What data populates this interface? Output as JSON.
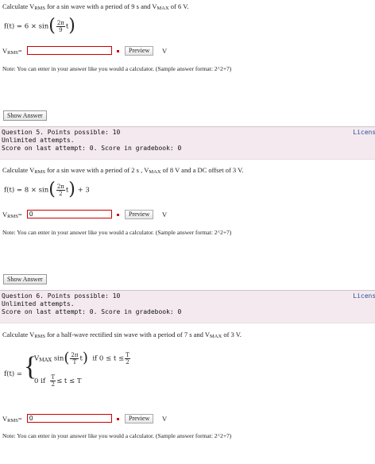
{
  "q4": {
    "text_pre": "Calculate V",
    "text_sub": "RMS",
    "text_mid": " for a sin wave with a period of 9 s and V",
    "text_sub2": "MAX",
    "text_post": " of 6 V.",
    "formula_lhs": "f(t) = 6 × sin",
    "frac_num": "2π",
    "frac_den": "9",
    "formula_t": "t",
    "vrms_label": "V",
    "vrms_sub": "RMS",
    "vrms_eq": "=",
    "input_value": "",
    "preview_label": "Preview",
    "unit": "V",
    "note": "Note: You can enter in your answer like you would a calculator. (Sample answer format: 2^2+7)",
    "show_answer": "Show Answer"
  },
  "q5": {
    "header_line1": "Question 5. Points possible: 10",
    "header_line2": "Unlimited attempts.",
    "header_line3": "Score on last attempt: 0. Score in gradebook: 0",
    "license": "License",
    "text_pre": "Calculate V",
    "text_sub": "RMS",
    "text_mid": " for a sin wave with a period of 2 s , V",
    "text_sub2": "MAX",
    "text_post": " of 8 V and a DC offset of 3 V.",
    "formula_lhs": "f(t) = 8 × sin",
    "frac_num": "2π",
    "frac_den": "2",
    "formula_t": "t",
    "formula_tail": "+ 3",
    "vrms_label": "V",
    "vrms_sub": "RMS",
    "vrms_eq": "=",
    "input_value": "0",
    "preview_label": "Preview",
    "unit": "V",
    "note": "Note: You can enter in your answer like you would a calculator. (Sample answer format: 2^2+7)",
    "show_answer": "Show Answer"
  },
  "q6": {
    "header_line1": "Question 6. Points possible: 10",
    "header_line2": "Unlimited attempts.",
    "header_line3": "Score on last attempt: 0. Score in gradebook: 0",
    "license": "License",
    "text_pre": "Calculate V",
    "text_sub": "RMS",
    "text_mid": " for a half-wave rectified  sin wave with a period of 7 s and V",
    "text_sub2": "MAX",
    "text_post": " of 3 V.",
    "formula_lhs": "f(t) =",
    "case1_vmax": "V",
    "case1_vmax_sub": "MAX",
    "case1_sin": "sin",
    "case1_frac_num": "2π",
    "case1_frac_den": "T",
    "case1_t": "t",
    "case1_cond": "if  0 ≤ t ≤",
    "case1_cond_num": "T",
    "case1_cond_den": "2",
    "case2_val": "0  if",
    "case2_num": "T",
    "case2_den": "2",
    "case2_cond": "≤ t ≤ T",
    "vrms_label": "V",
    "vrms_sub": "RMS",
    "vrms_eq": "=",
    "input_value": "0",
    "preview_label": "Preview",
    "unit": "V",
    "note": "Note: You can enter in your answer like you would a calculator. (Sample answer format: 2^2+7)"
  }
}
